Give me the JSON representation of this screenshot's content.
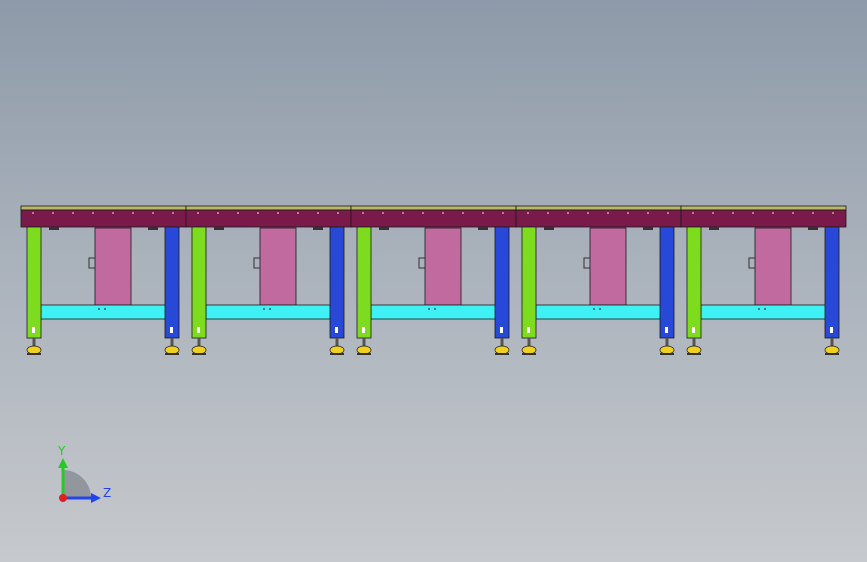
{
  "viewport": {
    "background_top": "#8e9aa9",
    "background_bottom": "#c6c9cd"
  },
  "model": {
    "module_count": 5,
    "colors": {
      "tabletop": "#7a1a4a",
      "tabletop_edge": "#b8b86a",
      "left_leg": "#7ddc1e",
      "right_leg": "#2848d8",
      "crossbar": "#3ff0f5",
      "cabinet": "#c06aa0",
      "foot": "#f0d020",
      "outline": "#1a1a1a"
    }
  },
  "triad": {
    "y_label": "Y",
    "z_label": "Z",
    "y_color": "#22cc22",
    "z_color": "#2244ee",
    "origin_color": "#e02020",
    "label_color": "#2244ee"
  }
}
